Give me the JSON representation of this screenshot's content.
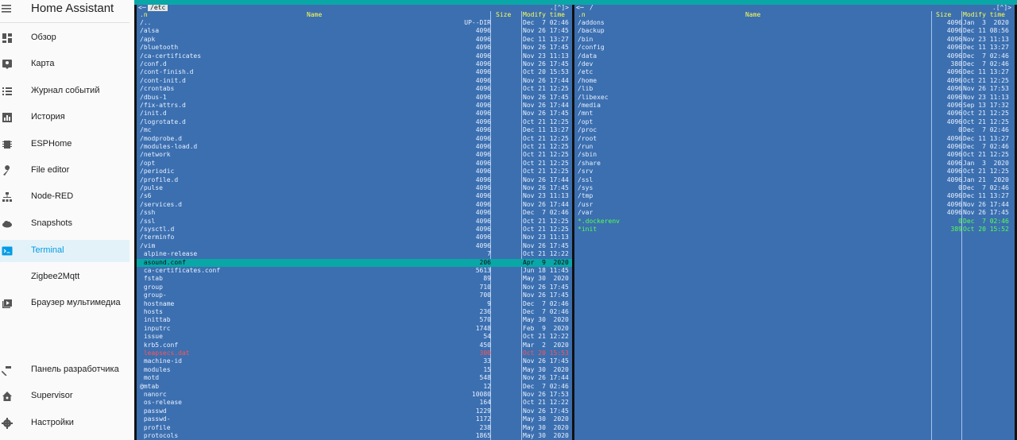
{
  "app": {
    "title": "Home Assistant"
  },
  "sidebar": {
    "items": [
      {
        "label": "Обзор",
        "icon": "dashboard-icon"
      },
      {
        "label": "Карта",
        "icon": "map-icon"
      },
      {
        "label": "Журнал событий",
        "icon": "logbook-icon"
      },
      {
        "label": "История",
        "icon": "history-icon"
      },
      {
        "label": "ESPHome",
        "icon": "chip-icon"
      },
      {
        "label": "File editor",
        "icon": "wrench-icon"
      },
      {
        "label": "Node-RED",
        "icon": "sitemap-icon"
      },
      {
        "label": "Snapshots",
        "icon": "cloud-icon"
      },
      {
        "label": "Terminal",
        "icon": "console-icon",
        "active": true
      },
      {
        "label": "Zigbee2Mqtt",
        "icon": ""
      },
      {
        "label": "Браузер мультимедиа",
        "icon": "media-icon"
      }
    ],
    "bottom": [
      {
        "label": "Панель разработчика",
        "icon": "hammer-icon"
      },
      {
        "label": "Supervisor",
        "icon": "home-assistant-icon"
      },
      {
        "label": "Настройки",
        "icon": "cog-icon"
      }
    ]
  },
  "left_panel": {
    "path": "/etc",
    "corner_left": "<─",
    "corner_right": ".[^]>",
    "headers": {
      "name_key": ".n",
      "name": "Name",
      "size": "Size",
      "time": "Modify time"
    },
    "rows": [
      {
        "name": "/..",
        "size": "UP--DIR",
        "time": "Dec  7 02:46"
      },
      {
        "name": "/alsa",
        "size": "4096",
        "time": "Nov 26 17:45"
      },
      {
        "name": "/apk",
        "size": "4096",
        "time": "Dec 11 13:27"
      },
      {
        "name": "/bluetooth",
        "size": "4096",
        "time": "Nov 26 17:45"
      },
      {
        "name": "/ca-certificates",
        "size": "4096",
        "time": "Nov 23 11:13"
      },
      {
        "name": "/conf.d",
        "size": "4096",
        "time": "Nov 26 17:45"
      },
      {
        "name": "/cont-finish.d",
        "size": "4096",
        "time": "Oct 20 15:53"
      },
      {
        "name": "/cont-init.d",
        "size": "4096",
        "time": "Nov 26 17:44"
      },
      {
        "name": "/crontabs",
        "size": "4096",
        "time": "Oct 21 12:25"
      },
      {
        "name": "/dbus-1",
        "size": "4096",
        "time": "Nov 26 17:45"
      },
      {
        "name": "/fix-attrs.d",
        "size": "4096",
        "time": "Nov 26 17:44"
      },
      {
        "name": "/init.d",
        "size": "4096",
        "time": "Nov 26 17:45"
      },
      {
        "name": "/logrotate.d",
        "size": "4096",
        "time": "Oct 21 12:25"
      },
      {
        "name": "/mc",
        "size": "4096",
        "time": "Dec 11 13:27"
      },
      {
        "name": "/modprobe.d",
        "size": "4096",
        "time": "Oct 21 12:25"
      },
      {
        "name": "/modules-load.d",
        "size": "4096",
        "time": "Oct 21 12:25"
      },
      {
        "name": "/network",
        "size": "4096",
        "time": "Oct 21 12:25"
      },
      {
        "name": "/opt",
        "size": "4096",
        "time": "Oct 21 12:25"
      },
      {
        "name": "/periodic",
        "size": "4096",
        "time": "Oct 21 12:25"
      },
      {
        "name": "/profile.d",
        "size": "4096",
        "time": "Nov 26 17:44"
      },
      {
        "name": "/pulse",
        "size": "4096",
        "time": "Nov 26 17:45"
      },
      {
        "name": "/s6",
        "size": "4096",
        "time": "Nov 23 11:13"
      },
      {
        "name": "/services.d",
        "size": "4096",
        "time": "Nov 26 17:44"
      },
      {
        "name": "/ssh",
        "size": "4096",
        "time": "Dec  7 02:46"
      },
      {
        "name": "/ssl",
        "size": "4096",
        "time": "Oct 21 12:25"
      },
      {
        "name": "/sysctl.d",
        "size": "4096",
        "time": "Oct 21 12:25"
      },
      {
        "name": "/terminfo",
        "size": "4096",
        "time": "Nov 23 11:13"
      },
      {
        "name": "/vim",
        "size": "4096",
        "time": "Nov 26 17:45"
      },
      {
        "name": " alpine-release",
        "size": "7",
        "time": "Oct 21 12:22"
      },
      {
        "name": " asound.conf",
        "size": "206",
        "time": "Apr  9  2020",
        "selected": true
      },
      {
        "name": " ca-certificates.conf",
        "size": "5613",
        "time": "Jun 18 11:45"
      },
      {
        "name": " fstab",
        "size": "89",
        "time": "May 30  2020"
      },
      {
        "name": " group",
        "size": "710",
        "time": "Nov 26 17:45"
      },
      {
        "name": " group-",
        "size": "700",
        "time": "Nov 26 17:45"
      },
      {
        "name": " hostname",
        "size": "9",
        "time": "Dec  7 02:46"
      },
      {
        "name": " hosts",
        "size": "236",
        "time": "Dec  7 02:46"
      },
      {
        "name": " inittab",
        "size": "570",
        "time": "May 30  2020"
      },
      {
        "name": " inputrc",
        "size": "1748",
        "time": "Feb  9  2020"
      },
      {
        "name": " issue",
        "size": "54",
        "time": "Oct 21 12:22"
      },
      {
        "name": " krb5.conf",
        "size": "450",
        "time": "Mar  2  2020"
      },
      {
        "name": " leapsecs.dat",
        "size": "300",
        "time": "Oct 20 15:53",
        "error": true
      },
      {
        "name": " machine-id",
        "size": "33",
        "time": "Nov 26 17:45"
      },
      {
        "name": " modules",
        "size": "15",
        "time": "May 30  2020"
      },
      {
        "name": " motd",
        "size": "548",
        "time": "Nov 26 17:44"
      },
      {
        "name": "@mtab",
        "size": "12",
        "time": "Dec  7 02:46"
      },
      {
        "name": " nanorc",
        "size": "10080",
        "time": "Nov 26 17:53"
      },
      {
        "name": " os-release",
        "size": "164",
        "time": "Oct 21 12:22"
      },
      {
        "name": " passwd",
        "size": "1229",
        "time": "Nov 26 17:45"
      },
      {
        "name": " passwd-",
        "size": "1172",
        "time": "May 30  2020"
      },
      {
        "name": " profile",
        "size": "238",
        "time": "May 30  2020"
      },
      {
        "name": " protocols",
        "size": "1865",
        "time": "May 30  2020"
      }
    ]
  },
  "right_panel": {
    "path": "/",
    "corner_left": "<─",
    "corner_right": ".[^]>",
    "headers": {
      "name_key": ".n",
      "name": "Name",
      "size": "Size",
      "time": "Modify time"
    },
    "rows": [
      {
        "name": "/addons",
        "size": "4096",
        "time": "Jan  3  2020"
      },
      {
        "name": "/backup",
        "size": "4096",
        "time": "Dec 11 08:56"
      },
      {
        "name": "/bin",
        "size": "4096",
        "time": "Nov 23 11:13"
      },
      {
        "name": "/config",
        "size": "4096",
        "time": "Dec 11 13:27"
      },
      {
        "name": "/data",
        "size": "4096",
        "time": "Dec  7 02:46"
      },
      {
        "name": "/dev",
        "size": "380",
        "time": "Dec  7 02:46"
      },
      {
        "name": "/etc",
        "size": "4096",
        "time": "Dec 11 13:27"
      },
      {
        "name": "/home",
        "size": "4096",
        "time": "Oct 21 12:25"
      },
      {
        "name": "/lib",
        "size": "4096",
        "time": "Nov 26 17:53"
      },
      {
        "name": "/libexec",
        "size": "4096",
        "time": "Nov 23 11:13"
      },
      {
        "name": "/media",
        "size": "4096",
        "time": "Sep 13 17:32"
      },
      {
        "name": "/mnt",
        "size": "4096",
        "time": "Oct 21 12:25"
      },
      {
        "name": "/opt",
        "size": "4096",
        "time": "Oct 21 12:25"
      },
      {
        "name": "/proc",
        "size": "0",
        "time": "Dec  7 02:46"
      },
      {
        "name": "/root",
        "size": "4096",
        "time": "Dec 11 13:27"
      },
      {
        "name": "/run",
        "size": "4096",
        "time": "Dec  7 02:46"
      },
      {
        "name": "/sbin",
        "size": "4096",
        "time": "Oct 21 12:25"
      },
      {
        "name": "/share",
        "size": "4096",
        "time": "Jan  3  2020"
      },
      {
        "name": "/srv",
        "size": "4096",
        "time": "Oct 21 12:25"
      },
      {
        "name": "/ssl",
        "size": "4096",
        "time": "Jan 21  2020"
      },
      {
        "name": "/sys",
        "size": "0",
        "time": "Dec  7 02:46"
      },
      {
        "name": "/tmp",
        "size": "4096",
        "time": "Dec 11 13:27"
      },
      {
        "name": "/usr",
        "size": "4096",
        "time": "Nov 26 17:44"
      },
      {
        "name": "/var",
        "size": "4096",
        "time": "Nov 26 17:45"
      },
      {
        "name": "*.dockerenv",
        "size": "0",
        "time": "Dec  7 02:46",
        "exec": true
      },
      {
        "name": "*init",
        "size": "389",
        "time": "Oct 20 15:52",
        "exec": true
      }
    ]
  }
}
